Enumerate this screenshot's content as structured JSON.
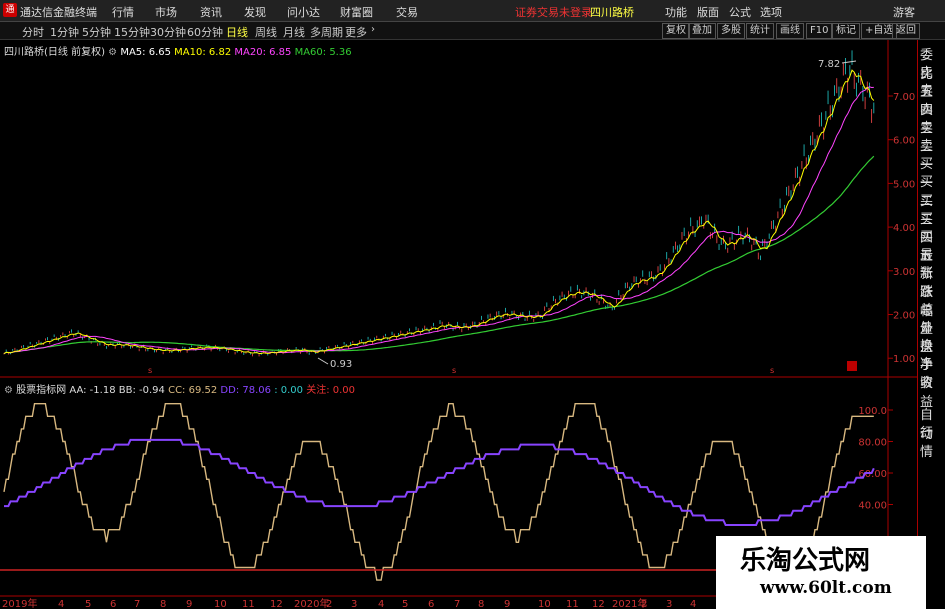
{
  "title_bar": {
    "app_name": "通达信金融终端",
    "menus": [
      "行情",
      "市场",
      "资讯",
      "发现",
      "问小达",
      "财富圈",
      "交易"
    ],
    "notice": "证券交易未登录",
    "stock_name": "四川路桥",
    "right_menus": [
      "功能",
      "版面",
      "公式",
      "选项"
    ],
    "guest": "游客"
  },
  "toolbar": {
    "periods": [
      "分时",
      "1分钟",
      "5分钟",
      "15分钟",
      "30分钟",
      "60分钟",
      "日线",
      "周线",
      "月线",
      "多周期",
      "更多"
    ],
    "active_period": "日线",
    "buttons": [
      "复权",
      "叠加",
      "多股",
      "统计",
      "画线",
      "F10",
      "标记",
      "+自选",
      "返回"
    ]
  },
  "main_legend": {
    "label": "四川路桥(日线 前复权)",
    "ma5": "MA5: 6.65",
    "ma10": "MA10: 6.82",
    "ma20": "MA20: 6.85",
    "ma60": "MA60: 5.36",
    "high_label": "7.82",
    "low_label": "0.93"
  },
  "price_axis": [
    "7.00",
    "6.00",
    "5.00",
    "4.00",
    "3.00",
    "2.00",
    "1.00"
  ],
  "indicator_legend": {
    "label": "股票指标网",
    "aa": "AA: -1.18",
    "bb": "BB: -0.94",
    "cc": "CC: 69.52",
    "dd": "DD: 78.06",
    "ee": ": 0.00",
    "gz": "关注: 0.00"
  },
  "indicator_axis": [
    "100.0",
    "80.00",
    "60.00",
    "40.00"
  ],
  "x_axis": [
    "2019年",
    "4",
    "5",
    "6",
    "7",
    "8",
    "9",
    "10",
    "11",
    "12",
    "2020年",
    "2",
    "3",
    "4",
    "5",
    "6",
    "7",
    "8",
    "9",
    "10",
    "11",
    "12",
    "2021年",
    "2",
    "3",
    "4",
    "5"
  ],
  "right_panel": [
    "委比",
    "卖五",
    "卖四",
    "卖三",
    "卖二",
    "卖一",
    "买一",
    "买二",
    "买三",
    "买四",
    "买五",
    "最新",
    "涨跌",
    "涨幅",
    "总量",
    "外盘",
    "换手",
    "净资",
    "收益",
    "自动",
    "行情"
  ],
  "watermark": {
    "line1": "乐淘公式网",
    "line2": "www.60lt.com"
  },
  "colors": {
    "ma5": "#ffffff",
    "ma10": "#ffff00",
    "ma20": "#ff44ff",
    "ma60": "#33cc33",
    "indicator_tan": "#d8b880",
    "indicator_purple": "#8844ff",
    "axis_red": "#aa0000"
  }
}
